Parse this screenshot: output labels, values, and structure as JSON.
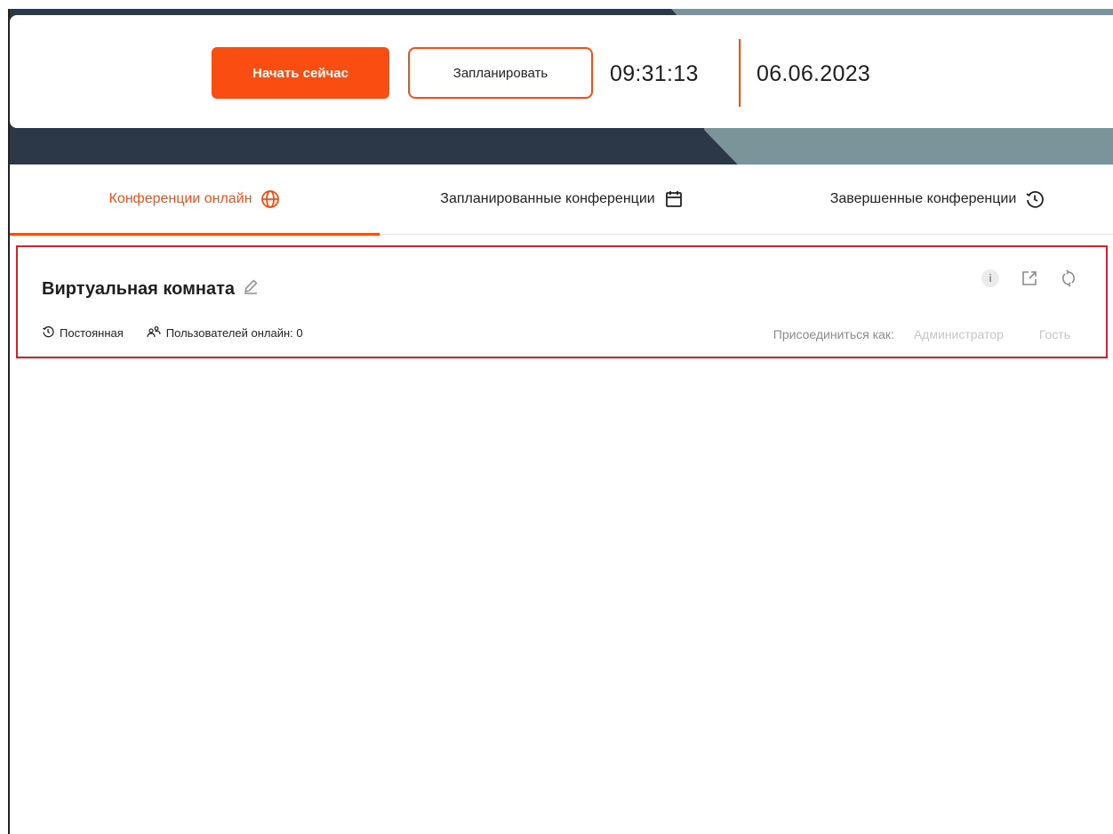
{
  "header": {
    "start_now_label": "Начать сейчас",
    "schedule_label": "Запланировать",
    "time": "09:31:13",
    "date": "06.06.2023"
  },
  "tabs": [
    {
      "label": "Конференции онлайн",
      "icon": "globe-icon",
      "active": true
    },
    {
      "label": "Запланированные конференции",
      "icon": "calendar-icon",
      "active": false
    },
    {
      "label": "Завершенные конференции",
      "icon": "history-icon",
      "active": false
    }
  ],
  "room": {
    "title": "Виртуальная комната",
    "type": "Постоянная",
    "users_online": "Пользователей онлайн: 0",
    "join_as_label": "Присоединиться как:",
    "join_admin": "Администратор",
    "join_guest": "Гость",
    "actions": [
      "info-icon",
      "external-link-icon",
      "refresh-icon"
    ]
  },
  "colors": {
    "accent": "#fa4d12",
    "header_dark": "#2c3848",
    "header_slate": "#7b949a",
    "highlight_border": "#e01b2a"
  }
}
